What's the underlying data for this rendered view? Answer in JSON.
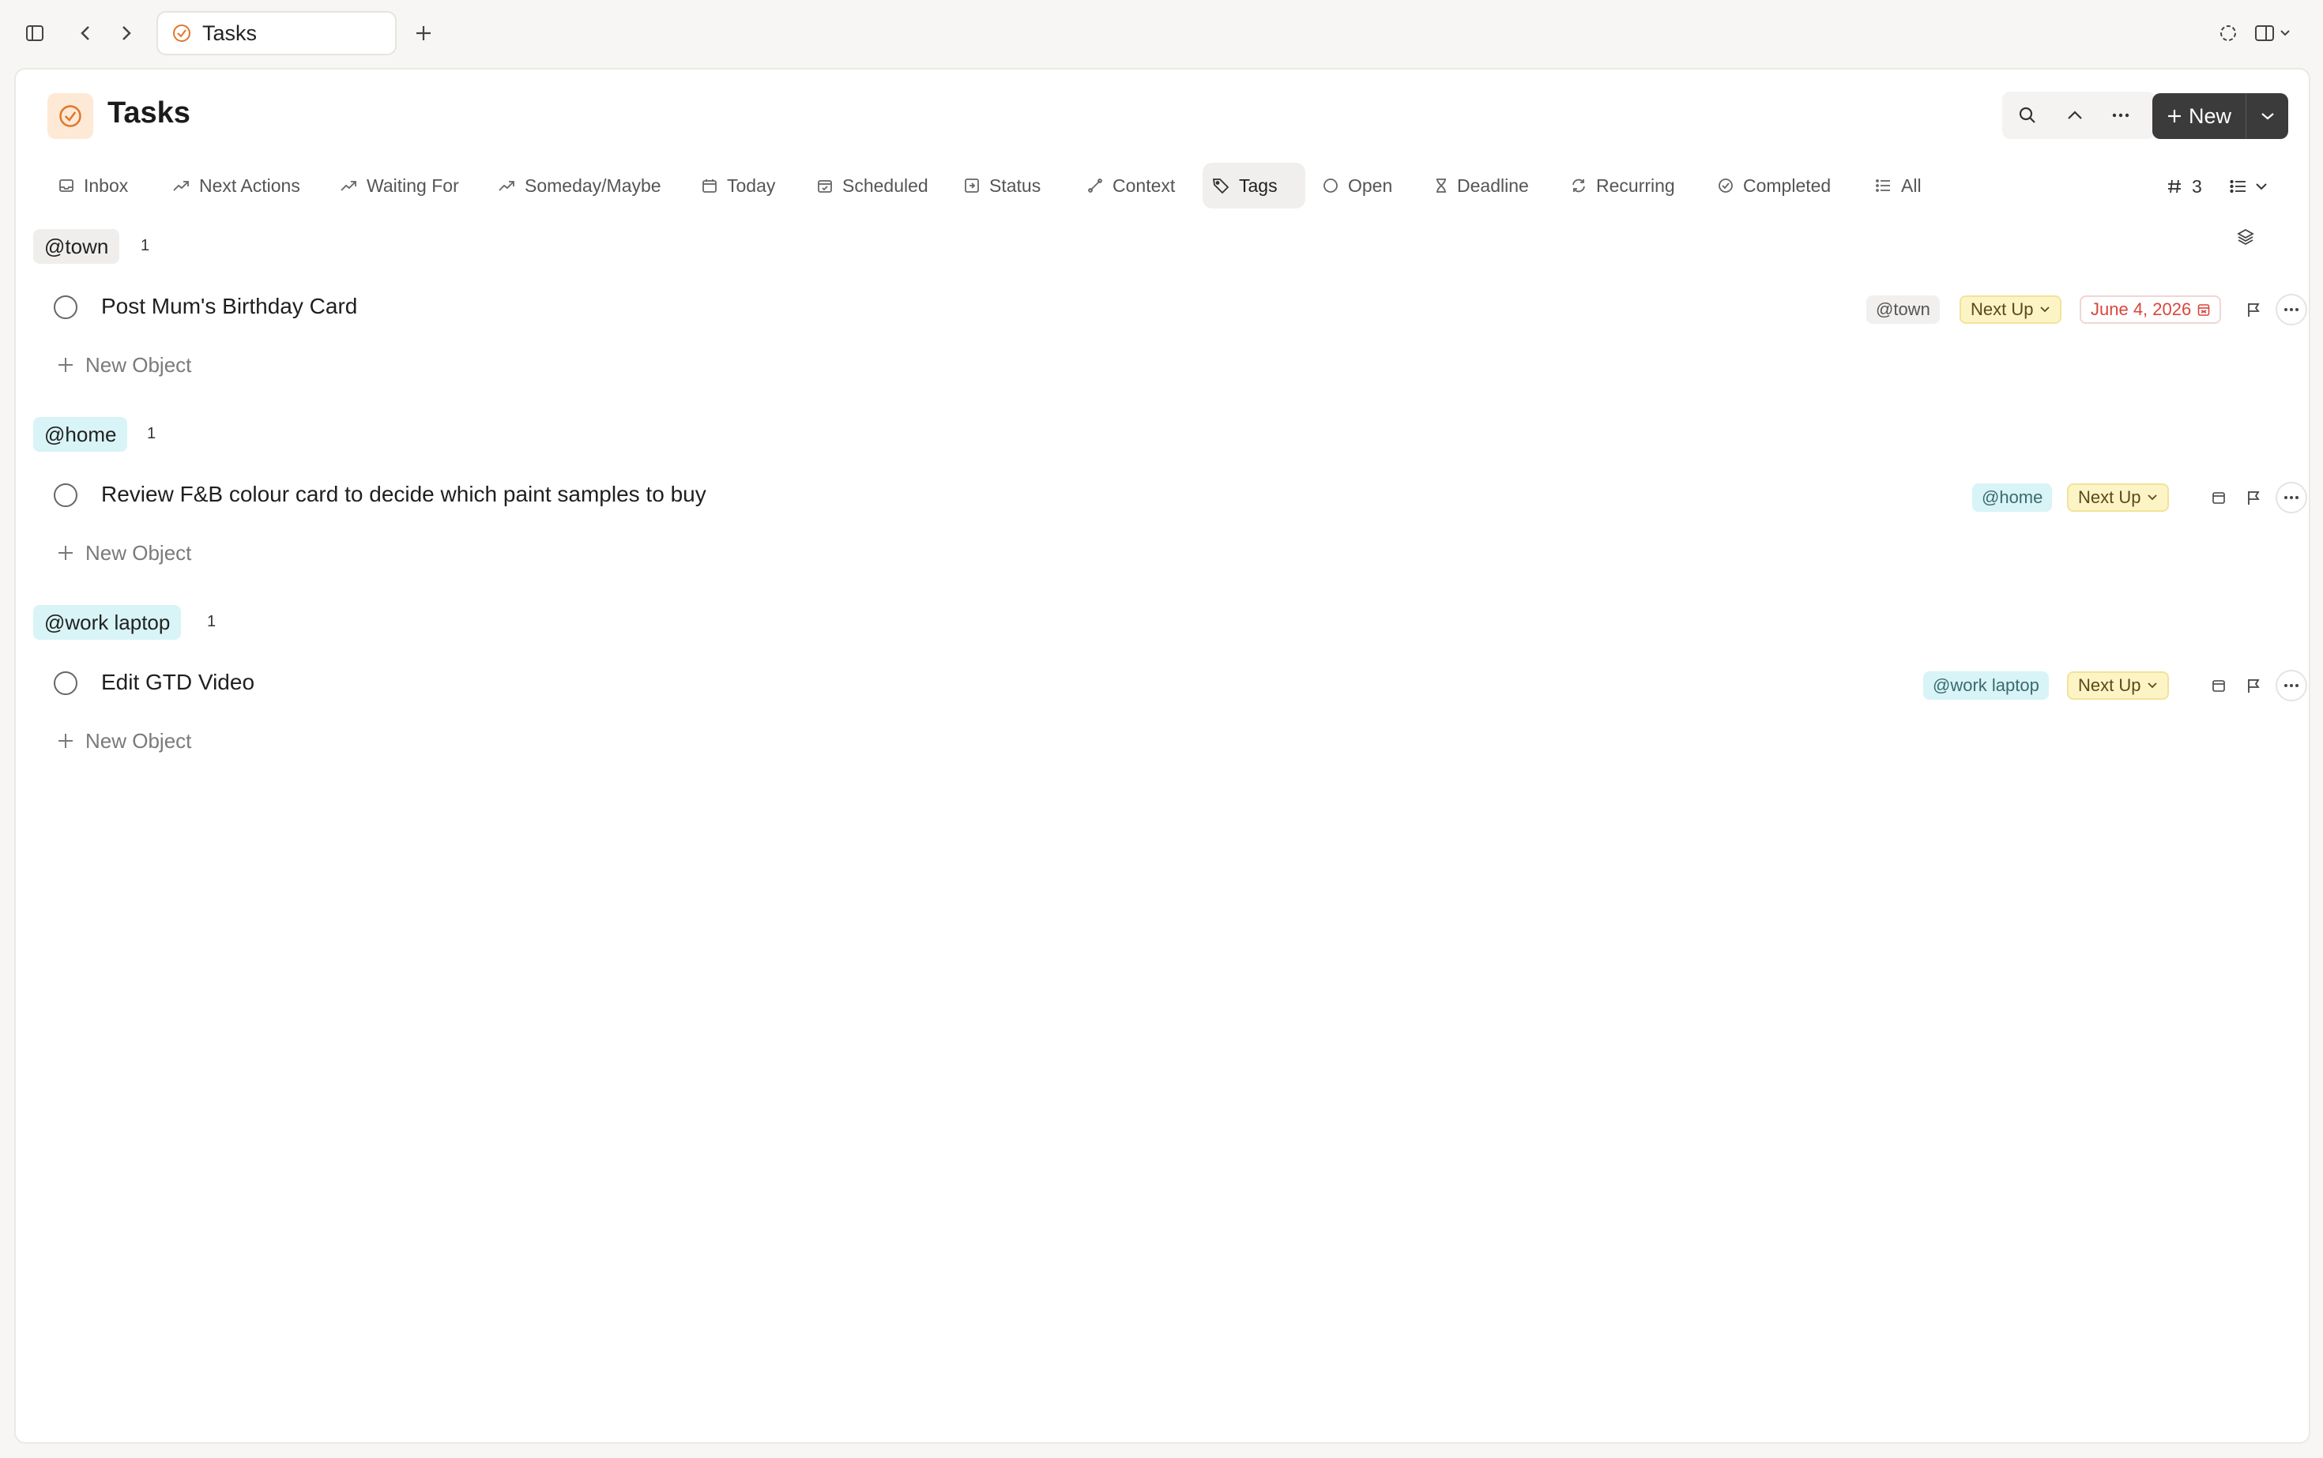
{
  "topbar": {
    "tab_title": "Tasks"
  },
  "header": {
    "title": "Tasks",
    "new_label": "New"
  },
  "views": [
    {
      "label": "Inbox",
      "icon": "inbox-icon"
    },
    {
      "label": "Next Actions",
      "icon": "trending-up-icon"
    },
    {
      "label": "Waiting For",
      "icon": "trending-up-icon"
    },
    {
      "label": "Someday/Maybe",
      "icon": "trending-up-icon"
    },
    {
      "label": "Today",
      "icon": "calendar-icon"
    },
    {
      "label": "Scheduled",
      "icon": "calendar-check-icon"
    },
    {
      "label": "Status",
      "icon": "status-icon"
    },
    {
      "label": "Context",
      "icon": "link-icon"
    },
    {
      "label": "Tags",
      "icon": "tag-icon",
      "active": true
    },
    {
      "label": "Open",
      "icon": "circle-icon"
    },
    {
      "label": "Deadline",
      "icon": "hourglass-icon"
    },
    {
      "label": "Recurring",
      "icon": "refresh-icon"
    },
    {
      "label": "Completed",
      "icon": "check-circle-icon"
    },
    {
      "label": "All",
      "icon": "list-icon"
    }
  ],
  "controls": {
    "group_count": "3"
  },
  "groups": [
    {
      "label": "@town",
      "count": "1",
      "task": {
        "title": "Post Mum's Birthday Card",
        "context": "@town",
        "status": "Next Up",
        "date": "June 4, 2026"
      },
      "new_object": "New Object"
    },
    {
      "label": "@home",
      "count": "1",
      "task": {
        "title": "Review F&B colour card to decide which paint samples to buy",
        "context": "@home",
        "status": "Next Up"
      },
      "new_object": "New Object"
    },
    {
      "label": "@work laptop",
      "count": "1",
      "task": {
        "title": "Edit GTD Video",
        "context": "@work laptop",
        "status": "Next Up"
      },
      "new_object": "New Object"
    }
  ],
  "colors": {
    "accent_orange": "#e0772a",
    "dark_button": "#3b3b3b",
    "context_cyan": "#d8f4f6",
    "status_yellow": "#fdf4c6",
    "date_red": "#d9463d"
  }
}
